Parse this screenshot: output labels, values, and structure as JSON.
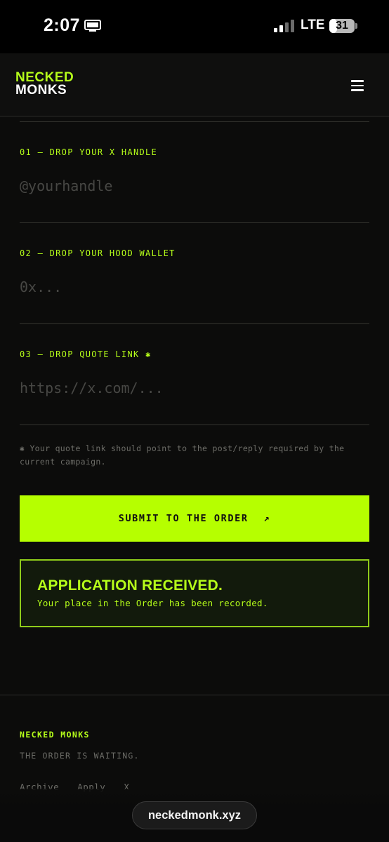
{
  "status_bar": {
    "time": "2:07",
    "network": "LTE",
    "battery_level": "31",
    "battery_fraction": 0.31,
    "signal_bars": 2,
    "icons": [
      "screen-mirroring-icon",
      "signal-icon",
      "battery-icon"
    ]
  },
  "header": {
    "logo_line1": "NECKED",
    "logo_line2": "MONKS",
    "menu_icon": "hamburger-menu-icon"
  },
  "form": {
    "fields": [
      {
        "label": "01 — DROP YOUR X HANDLE",
        "placeholder": "@yourhandle",
        "value": ""
      },
      {
        "label": "02 — DROP YOUR HOOD WALLET",
        "placeholder": "0x...",
        "value": ""
      },
      {
        "label": "03 — DROP QUOTE LINK ✱",
        "placeholder": "https://x.com/...",
        "value": ""
      }
    ],
    "note": "✱ Your quote link should point to the post/reply required by the current campaign.",
    "submit_label": "SUBMIT TO THE ORDER",
    "submit_arrow": "↗"
  },
  "success": {
    "title": "APPLICATION RECEIVED.",
    "message": "Your place in the Order has been recorded."
  },
  "footer": {
    "brand": "NECKED MONKS",
    "tagline": "THE ORDER IS WAITING.",
    "links": [
      "Archive",
      "Apply",
      "X"
    ]
  },
  "browser": {
    "url": "neckedmonk.xyz"
  },
  "colors": {
    "accent": "#b6ff00",
    "background": "#0c0c0b",
    "muted_text": "#6c6c67"
  }
}
